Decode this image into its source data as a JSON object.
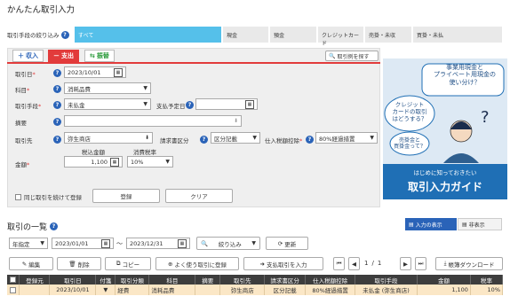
{
  "app": {
    "title": "かんたん取引入力"
  },
  "filter": {
    "label": "取引手段の絞り込み",
    "tabs": [
      "すべて",
      "現金",
      "預金",
      "クレジットカード",
      "売掛・未収",
      "買掛・未払"
    ]
  },
  "entry": {
    "tabs": {
      "income": "収入",
      "expense": "支出",
      "transfer": "振替"
    },
    "example_button": "取引例を探す",
    "labels": {
      "date": "取引日",
      "account": "科目",
      "method": "取引手段",
      "payment_due": "支払予定日",
      "memo": "摘要",
      "partner": "取引先",
      "invoice_type": "請求書区分",
      "purchase_tax": "仕入税額控除",
      "amount": "金額",
      "tax_incl": "税込金額",
      "tax_rate": "消費税率"
    },
    "values": {
      "date": "2023/10/01",
      "account": "消耗品費",
      "method": "未払金",
      "payment_due": "",
      "memo": "",
      "partner": "弥生商店",
      "invoice_type": "区分記載",
      "purchase_tax": "80%経過措置",
      "amount": "1,100",
      "tax_rate": "10%"
    },
    "continue_label": "同じ取引を続けて登録",
    "register_button": "登録",
    "clear_button": "クリア"
  },
  "ad": {
    "bubble1": "事業用現金と\nプライベート用現金の\n使い分け？",
    "bubble2": "クレジット\nカードの取引\nはどうする？",
    "bubble3": "売掛金と\n買掛金って？",
    "subtitle": "はじめに知っておきたい",
    "title": "取引入力ガイド"
  },
  "list": {
    "title": "取引の一覧",
    "toggle_show": "入力の表示",
    "toggle_hide": "非表示",
    "period_type": "年指定",
    "date_from": "2023/01/01",
    "tilde": "～",
    "date_to": "2023/12/31",
    "filter_button": "絞り込み",
    "refresh_button": "更新",
    "actions": {
      "edit": "編集",
      "delete": "削除",
      "copy": "コピー",
      "register_frequent": "よく使う取引に登録",
      "payment": "支払取引を入力",
      "download": "帳簿ダウンロード"
    },
    "pager": {
      "current": "1",
      "sep": "/",
      "total": "1"
    },
    "columns": [
      "",
      "登録元",
      "取引日",
      "付箋",
      "取引分類",
      "科目",
      "摘要",
      "取引先",
      "請求書区分",
      "仕入税額控除",
      "取引手段",
      "金額",
      "税率"
    ],
    "rows": [
      [
        "",
        "",
        "2023/10/01",
        "",
        "経費",
        "消耗品費",
        "",
        "弥生商店",
        "区分記載",
        "80%経過措置",
        "未払金 (弥生商店)",
        "1,100",
        "10%"
      ]
    ]
  }
}
